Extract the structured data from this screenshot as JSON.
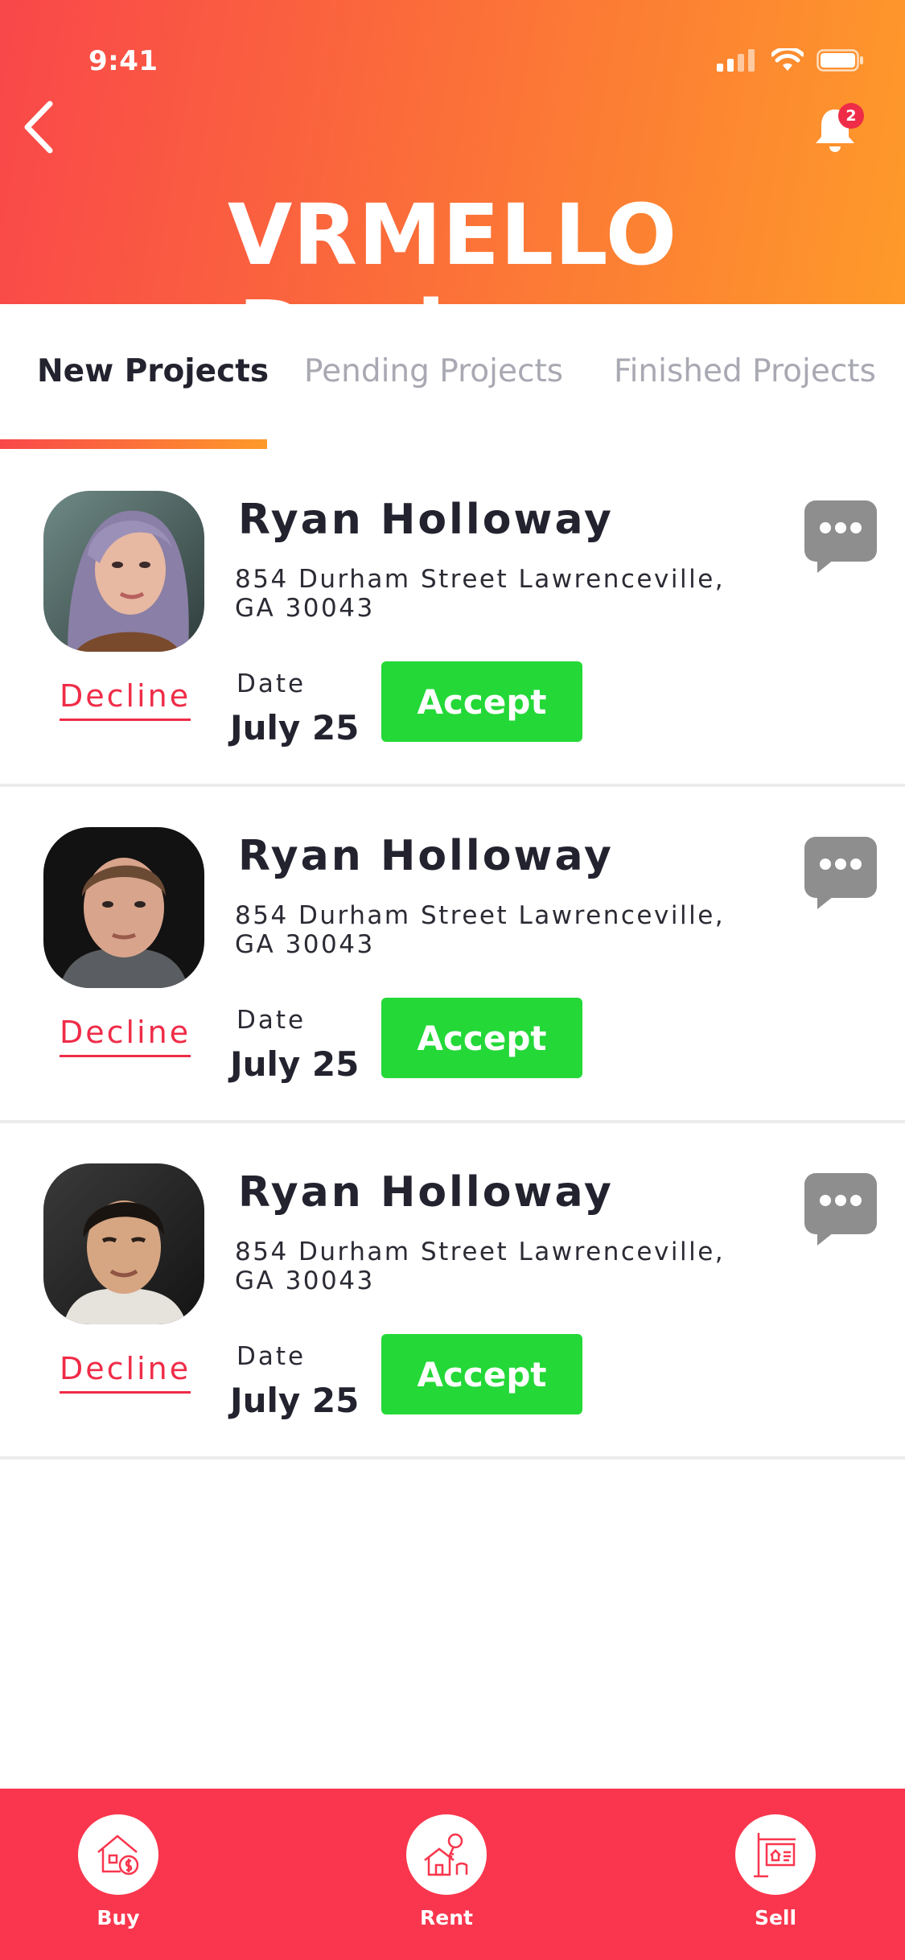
{
  "status_bar": {
    "time": "9:41"
  },
  "header": {
    "title": "VRMELLO Designer",
    "notification_count": "2"
  },
  "tabs": [
    {
      "label": "New Projects",
      "active": true
    },
    {
      "label": "Pending Projects",
      "active": false
    },
    {
      "label": "Finished Projects",
      "active": false
    }
  ],
  "projects": [
    {
      "name": "Ryan Holloway",
      "address_line1": "854 Durham Street Lawrenceville,",
      "address_line2": "GA 30043",
      "date_label": "Date",
      "date": "July 25",
      "decline_label": "Decline",
      "accept_label": "Accept"
    },
    {
      "name": "Ryan Holloway",
      "address_line1": "854 Durham Street Lawrenceville,",
      "address_line2": "GA 30043",
      "date_label": "Date",
      "date": "July 25",
      "decline_label": "Decline",
      "accept_label": "Accept"
    },
    {
      "name": "Ryan Holloway",
      "address_line1": "854 Durham Street Lawrenceville,",
      "address_line2": "GA 30043",
      "date_label": "Date",
      "date": "July 25",
      "decline_label": "Decline",
      "accept_label": "Accept"
    }
  ],
  "bottom_nav": [
    {
      "label": "Buy",
      "icon": "house-money-icon"
    },
    {
      "label": "Rent",
      "icon": "house-key-icon"
    },
    {
      "label": "Sell",
      "icon": "sale-sign-icon"
    }
  ],
  "colors": {
    "header_gradient_start": "#f9474a",
    "header_gradient_end": "#fe9a2a",
    "accept_green": "#24d838",
    "decline_red": "#ef2c48",
    "bottom_nav_bg": "#f9364d"
  }
}
